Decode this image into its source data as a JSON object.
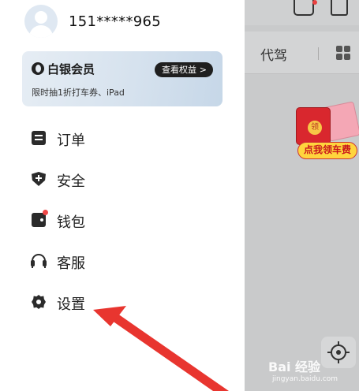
{
  "user": {
    "phone": "151*****965"
  },
  "member_card": {
    "title": "白银会员",
    "benefits_button": "查看权益",
    "benefits_chevron": ">",
    "subtitle": "限时抽1折打车券、iPad"
  },
  "menu": {
    "items": [
      {
        "label": "订单",
        "icon": "order-icon"
      },
      {
        "label": "安全",
        "icon": "shield-icon"
      },
      {
        "label": "钱包",
        "icon": "wallet-icon"
      },
      {
        "label": "客服",
        "icon": "headset-icon"
      },
      {
        "label": "设置",
        "icon": "gear-icon"
      }
    ]
  },
  "background_app": {
    "tab_label": "代驾",
    "promo_label": "点我领车费",
    "promo_coin": "领"
  },
  "watermark": {
    "brand": "Bai 经验",
    "url": "jingyan.baidu.com"
  },
  "colors": {
    "accent_red": "#e8352f",
    "promo_yellow": "#ffd53d",
    "card_gradient_start": "#e6edf4",
    "card_gradient_end": "#c6d7e8"
  }
}
